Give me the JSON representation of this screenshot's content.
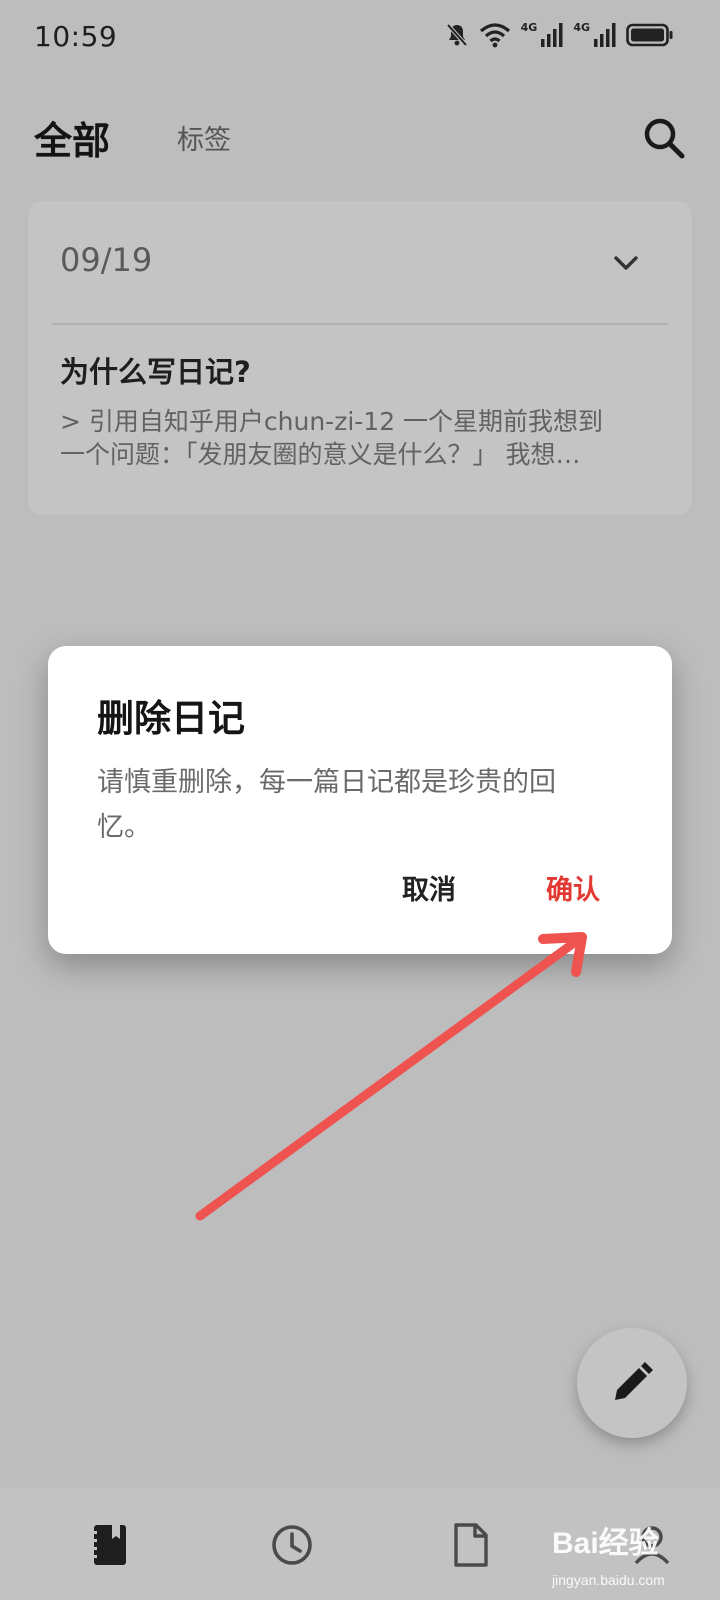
{
  "status_bar": {
    "time": "10:59",
    "network_labels": [
      "4G",
      "4G"
    ],
    "icons": [
      "bell-off-icon",
      "wifi-icon",
      "signal-icon",
      "signal-icon",
      "battery-icon"
    ]
  },
  "header": {
    "tab_all": "全部",
    "tab_tags": "标签",
    "search_icon": "search-icon"
  },
  "entry": {
    "date": "09/19",
    "title": "为什么写日记?",
    "excerpt": "> 引用自知乎用户chun-zi-12 一个星期前我想到\n一个问题：「发朋友圈的意义是什么？」 我想…"
  },
  "dialog": {
    "title": "删除日记",
    "message": "请慎重删除，每一篇日记都是珍贵的回忆。",
    "cancel_label": "取消",
    "confirm_label": "确认"
  },
  "annotation": {
    "color": "#ef5350"
  },
  "fab": {
    "icon": "pencil-icon"
  },
  "bottom_nav": {
    "items": [
      {
        "icon": "diary-book-icon"
      },
      {
        "icon": "clock-icon"
      },
      {
        "icon": "document-icon"
      },
      {
        "icon": "profile-icon"
      }
    ]
  },
  "watermark": {
    "logo": "Bai经验",
    "url": "jingyan.baidu.com"
  },
  "colors": {
    "overlay_background": "#bdbdbd",
    "dialog_background": "#ffffff",
    "confirm_accent": "#e23a33"
  }
}
